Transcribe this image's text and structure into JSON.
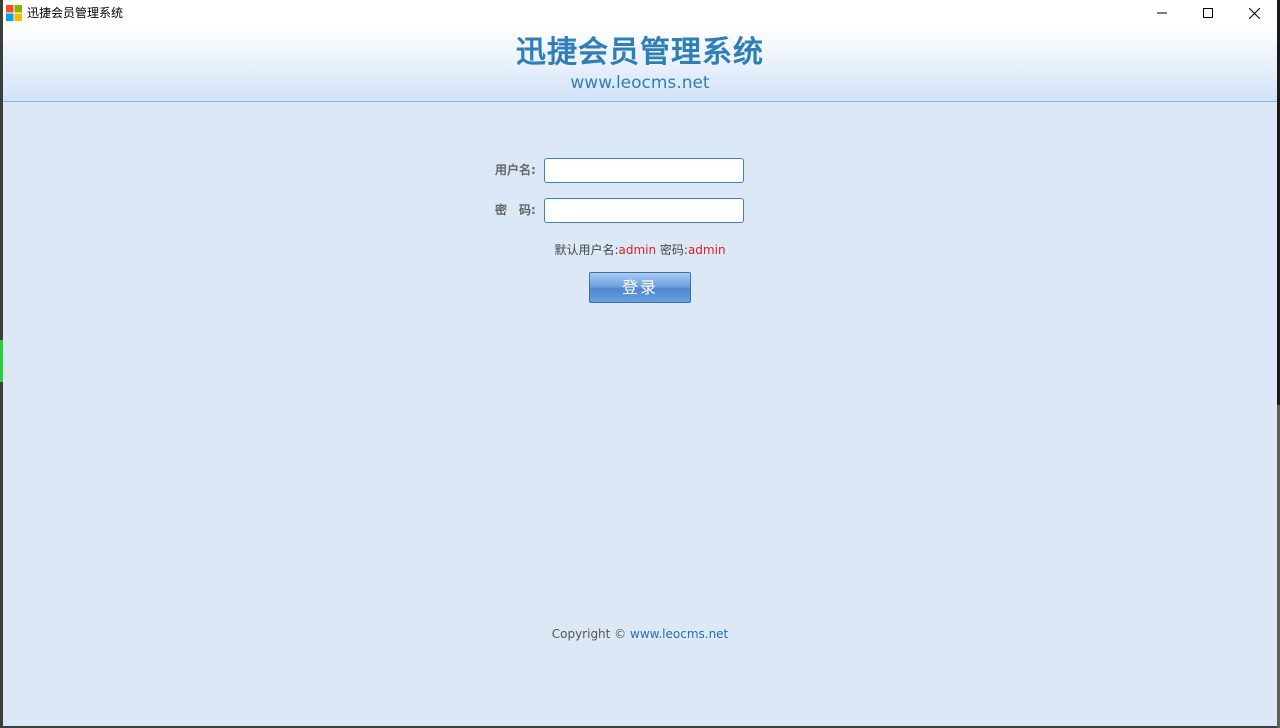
{
  "window": {
    "title": "迅捷会员管理系统"
  },
  "header": {
    "title": "迅捷会员管理系统",
    "url": "www.leocms.net"
  },
  "form": {
    "username_label": "用户名:",
    "password_label": "密　码:",
    "username_value": "",
    "password_value": ""
  },
  "hint": {
    "prefix_user": "默认用户名:",
    "user_value": "admin",
    "prefix_pass": " 密码:",
    "pass_value": "admin"
  },
  "login_button": {
    "label": "登录"
  },
  "footer": {
    "copyright_text": "Copyright © ",
    "link_text": "www.leocms.net"
  },
  "colors": {
    "accent": "#2e7fb8",
    "background": "#dde8f6",
    "hint_red": "#e02020"
  },
  "icons": {
    "app": "app-windows-logo-icon",
    "minimize": "minimize-icon",
    "maximize": "maximize-icon",
    "close": "close-icon"
  }
}
